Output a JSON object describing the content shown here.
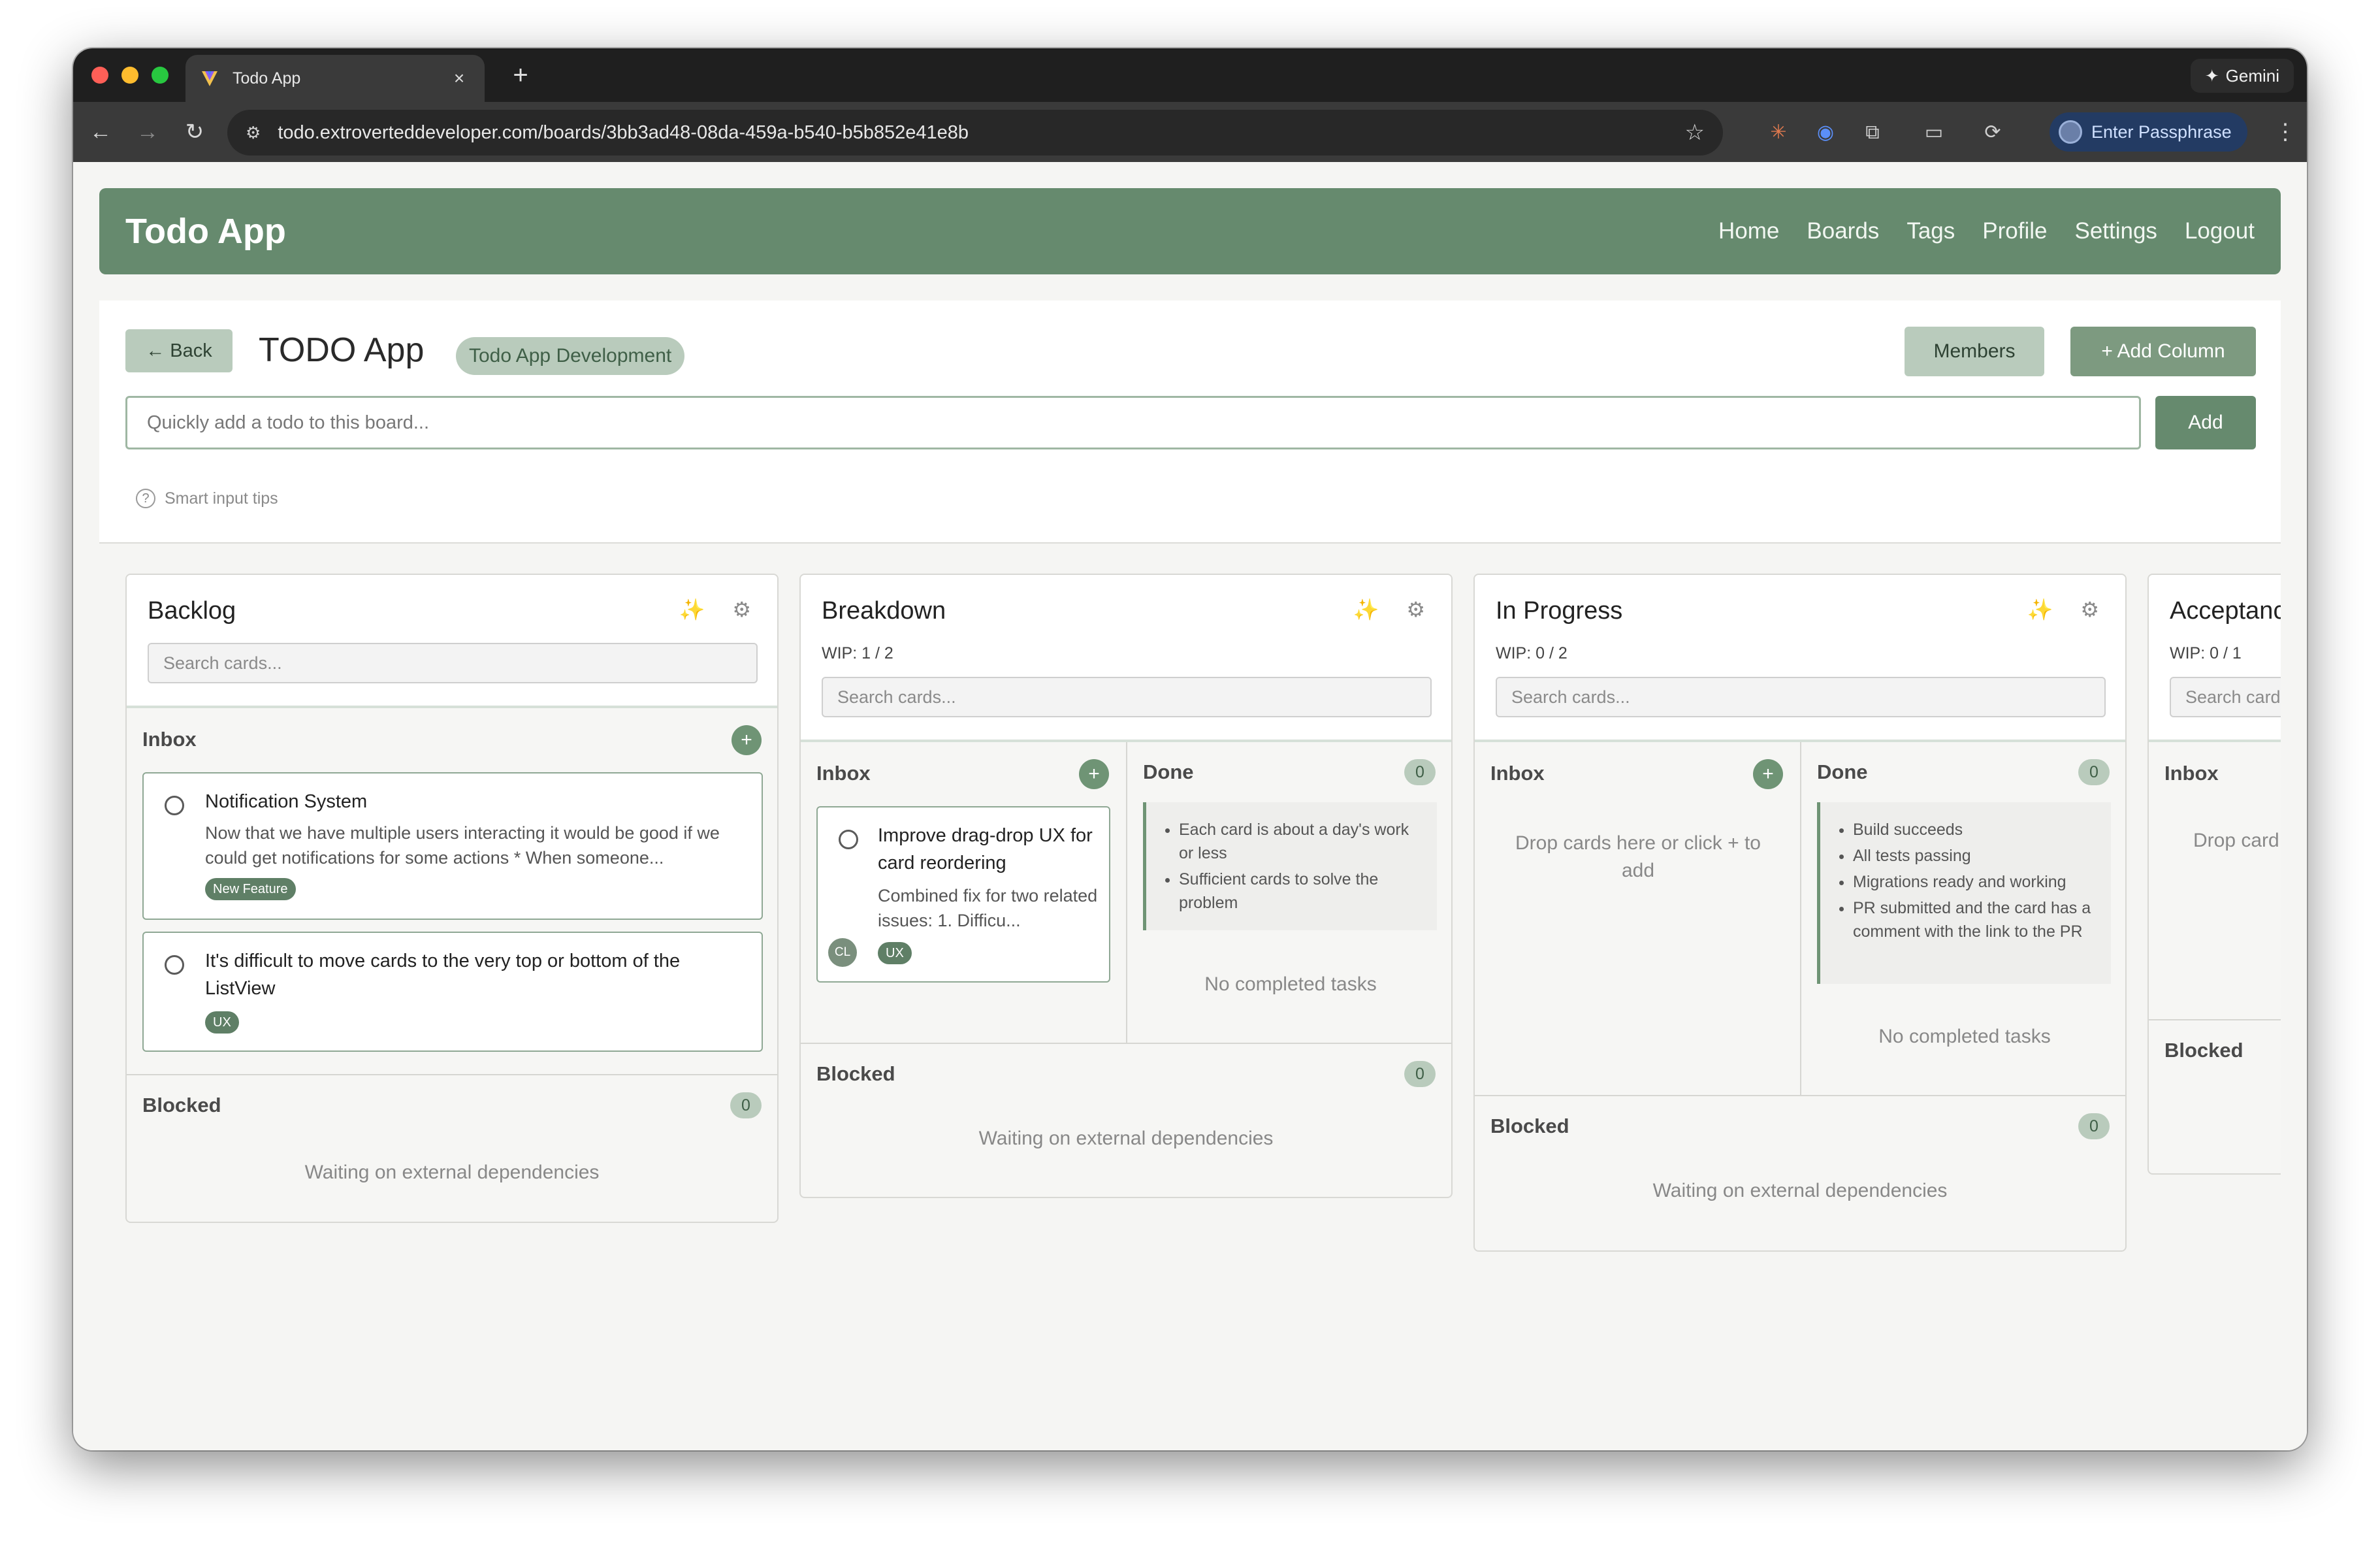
{
  "browser": {
    "tab_title": "Todo App",
    "tab_close": "×",
    "new_tab": "+",
    "gemini_label": "Gemini",
    "url": "todo.extroverteddeveloper.com/boards/3bb3ad48-08da-459a-b540-b5b852e41e8b",
    "passphrase_label": "Enter Passphrase"
  },
  "app": {
    "title": "Todo App",
    "nav": [
      "Home",
      "Boards",
      "Tags",
      "Profile",
      "Settings",
      "Logout"
    ]
  },
  "board": {
    "back_label": "← Back",
    "title": "TODO App",
    "tag": "Todo App Development",
    "members_label": "Members",
    "add_column_label": "+ Add Column",
    "quick_add_placeholder": "Quickly add a todo to this board...",
    "add_label": "Add",
    "tips_label": "Smart input tips"
  },
  "columns": {
    "backlog": {
      "title": "Backlog",
      "search_placeholder": "Search cards...",
      "inbox_title": "Inbox",
      "cards": [
        {
          "title": "Notification System",
          "description": "Now that we have multiple users interacting it would be good if we could get notifications for some actions * When someone...",
          "tag": "New Feature"
        },
        {
          "title": "It's difficult to move cards to the very top or bottom of the ListView",
          "tag": "UX"
        }
      ],
      "blocked_title": "Blocked",
      "blocked_count": "0",
      "blocked_empty": "Waiting on external dependencies"
    },
    "breakdown": {
      "title": "Breakdown",
      "wip": "WIP: 1 / 2",
      "search_placeholder": "Search cards...",
      "inbox_title": "Inbox",
      "card": {
        "title": "Improve drag-drop UX for card reordering",
        "description": "Combined fix for two related issues: 1. Difficu...",
        "avatar": "CL",
        "tag": "UX"
      },
      "done_title": "Done",
      "done_count": "0",
      "dod": [
        "Each card is about a day's work or less",
        "Sufficient cards to solve the problem"
      ],
      "done_empty": "No completed tasks",
      "blocked_title": "Blocked",
      "blocked_count": "0",
      "blocked_empty": "Waiting on external dependencies"
    },
    "in_progress": {
      "title": "In Progress",
      "wip": "WIP: 0 / 2",
      "search_placeholder": "Search cards...",
      "inbox_title": "Inbox",
      "inbox_empty": "Drop cards here or click + to add",
      "done_title": "Done",
      "done_count": "0",
      "dod": [
        "Build succeeds",
        "All tests passing",
        "Migrations ready and working",
        "PR submitted and the card has a comment with the link to the PR"
      ],
      "done_empty": "No completed tasks",
      "blocked_title": "Blocked",
      "blocked_count": "0",
      "blocked_empty": "Waiting on external dependencies"
    },
    "acceptance": {
      "title": "Acceptanc",
      "wip": "WIP: 0 / 1",
      "search_placeholder": "Search card",
      "inbox_title": "Inbox",
      "inbox_empty": "Drop card",
      "blocked_title": "Blocked"
    }
  },
  "colors": {
    "brand": "#668a6e",
    "accent_light": "#b9cbbc",
    "browser_chrome": "#1f1f1f"
  }
}
